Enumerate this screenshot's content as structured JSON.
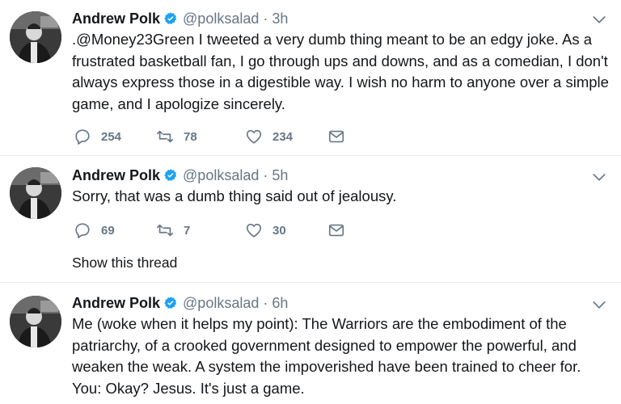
{
  "tweets": [
    {
      "name": "Andrew Polk",
      "handle": "@polksalad",
      "dot": "·",
      "time": "3h",
      "text": ".@Money23Green I tweeted a very dumb thing meant to be an edgy joke. As a frustrated basketball fan, I go through ups and downs, and as a comedian, I don't always express those in a digestible way. I wish no harm to anyone over a simple game, and I apologize sincerely.",
      "replies": "254",
      "retweets": "78",
      "likes": "234"
    },
    {
      "name": "Andrew Polk",
      "handle": "@polksalad",
      "dot": "·",
      "time": "5h",
      "text": "Sorry, that was a dumb thing said out of jealousy.",
      "replies": "69",
      "retweets": "7",
      "likes": "30",
      "show_thread": "Show this thread"
    },
    {
      "name": "Andrew Polk",
      "handle": "@polksalad",
      "dot": "·",
      "time": "6h",
      "text": "Me (woke when it helps my point): The Warriors are the embodiment of the patriarchy, of a crooked government designed to empower the powerful, and weaken the weak. A system the impoverished have been trained to cheer for. You: Okay? Jesus. It's just a game."
    }
  ],
  "colors": {
    "text": "#14171a",
    "secondary": "#657786",
    "verified": "#1da1f2",
    "divider": "#e6ecf0"
  },
  "icons": {
    "reply": "reply-icon",
    "retweet": "retweet-icon",
    "like": "heart-icon",
    "dm": "envelope-icon",
    "verified": "verified-badge-icon",
    "caret": "chevron-down-icon"
  }
}
